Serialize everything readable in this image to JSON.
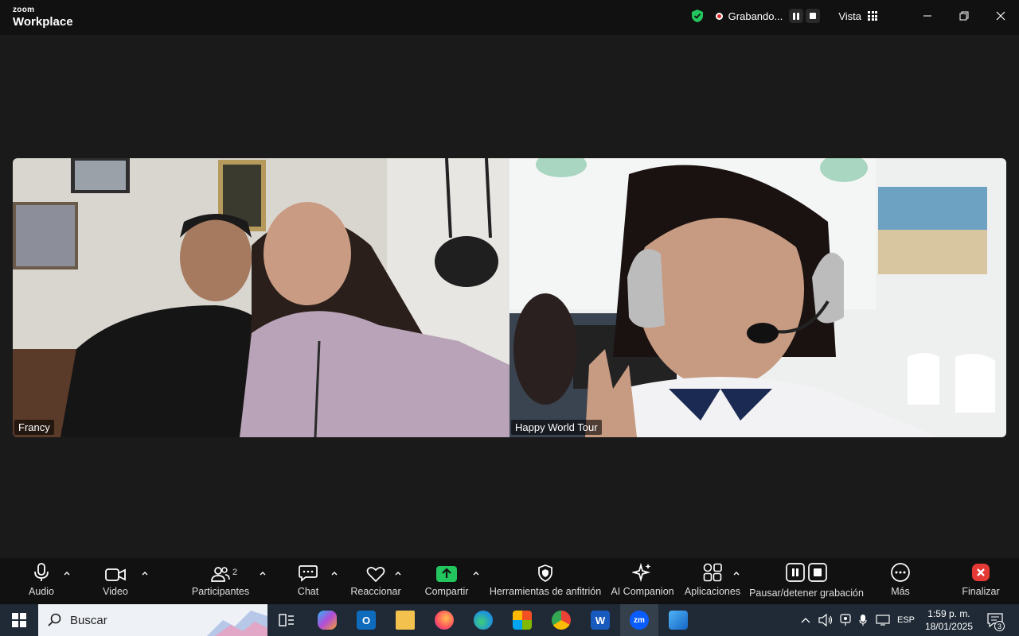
{
  "brand": {
    "small": "zoom",
    "name": "Workplace"
  },
  "recording": {
    "label": "Grabando..."
  },
  "view": {
    "label": "Vista"
  },
  "participants_tiles": [
    {
      "name": "Francy"
    },
    {
      "name": "Happy World Tour"
    }
  ],
  "toolbar": {
    "audio": "Audio",
    "video": "Video",
    "participants": "Participantes",
    "participants_count": "2",
    "chat": "Chat",
    "react": "Reaccionar",
    "share": "Compartir",
    "host_tools": "Herramientas de anfitrión",
    "ai": "AI Companion",
    "apps": "Aplicaciones",
    "pause_record": "Pausar/detener grabación",
    "more": "Más",
    "end": "Finalizar"
  },
  "taskbar": {
    "search_placeholder": "Buscar",
    "lang": "ESP",
    "time": "1:59 p. m.",
    "date": "18/01/2025",
    "notifications": "3"
  },
  "colors": {
    "shield": "#22c55e",
    "share_green": "#22c55e",
    "end_red": "#e53935",
    "taskbar": "#1f2a36"
  }
}
